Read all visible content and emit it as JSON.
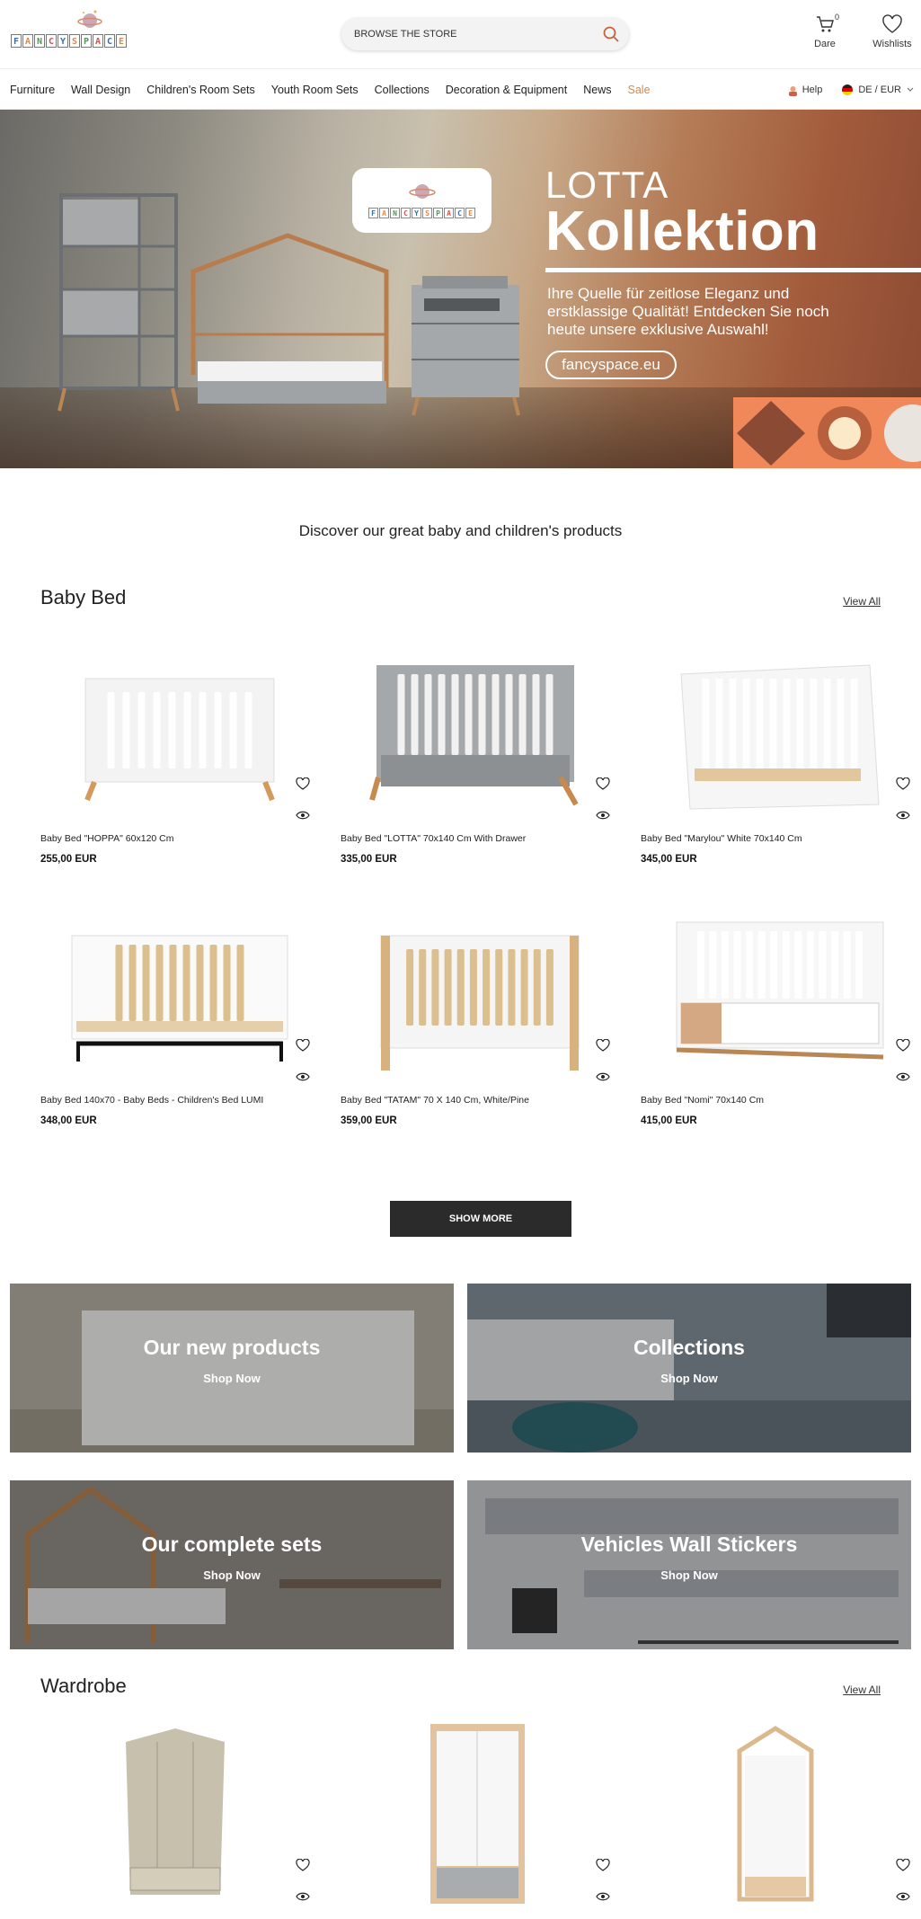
{
  "brand": {
    "logo_letters": [
      "F",
      "A",
      "N",
      "C",
      "Y",
      "S",
      "P",
      "A",
      "C",
      "E"
    ]
  },
  "header": {
    "search_placeholder": "BROWSE THE STORE",
    "cart_label": "Dare",
    "cart_count": "0",
    "wishlist_label": "Wishlists"
  },
  "nav": {
    "items": [
      "Furniture",
      "Wall Design",
      "Children's Room Sets",
      "Youth Room Sets",
      "Collections",
      "Decoration & Equipment",
      "News",
      "Sale"
    ],
    "help": "Help",
    "locale": "DE / EUR"
  },
  "hero": {
    "small_title": "LOTTA",
    "big_title": "Kollektion",
    "description": "Ihre Quelle für zeitlose Eleganz und erstklassige Qualität! Entdecken Sie noch heute unsere exklusive Auswahl!",
    "button": "fancyspace.eu",
    "card_letters": [
      "F",
      "A",
      "N",
      "C",
      "Y",
      "S",
      "P",
      "A",
      "C",
      "E"
    ]
  },
  "tagline": "Discover our great baby and children's products",
  "baby_bed": {
    "title": "Baby Bed",
    "view_all": "View All",
    "products": [
      {
        "name": "Baby Bed \"HOPPA\" 60x120 Cm",
        "price": "255,00 EUR",
        "style": "white-oak"
      },
      {
        "name": "Baby Bed \"LOTTA\" 70x140 Cm With Drawer",
        "price": "335,00 EUR",
        "style": "grey"
      },
      {
        "name": "Baby Bed \"Marylou\" White 70x140 Cm",
        "price": "345,00 EUR",
        "style": "white"
      },
      {
        "name": "Baby Bed 140x70 - Baby Beds - Children's Bed LUMI",
        "price": "348,00 EUR",
        "style": "lumi"
      },
      {
        "name": "Baby Bed \"TATAM\" 70 X 140 Cm, White/Pine",
        "price": "359,00 EUR",
        "style": "pine"
      },
      {
        "name": "Baby Bed \"Nomi\" 70x140 Cm",
        "price": "415,00 EUR",
        "style": "nomi"
      }
    ],
    "show_more": "SHOW MORE"
  },
  "banners": [
    {
      "title": "Our new products",
      "link": "Shop Now",
      "bg": "#8a8578"
    },
    {
      "title": "Collections",
      "link": "Shop Now",
      "bg": "#5d6b78"
    },
    {
      "title": "Our complete sets",
      "link": "Shop Now",
      "bg": "#6f6862"
    },
    {
      "title": "Vehicles Wall Stickers",
      "link": "Shop Now",
      "bg": "#9aa0a8"
    }
  ],
  "wardrobe": {
    "title": "Wardrobe",
    "view_all": "View All"
  },
  "colors": {
    "accent": "#d08b50",
    "dark_button": "#2b2b2b",
    "search_icon": "#c8643c"
  }
}
